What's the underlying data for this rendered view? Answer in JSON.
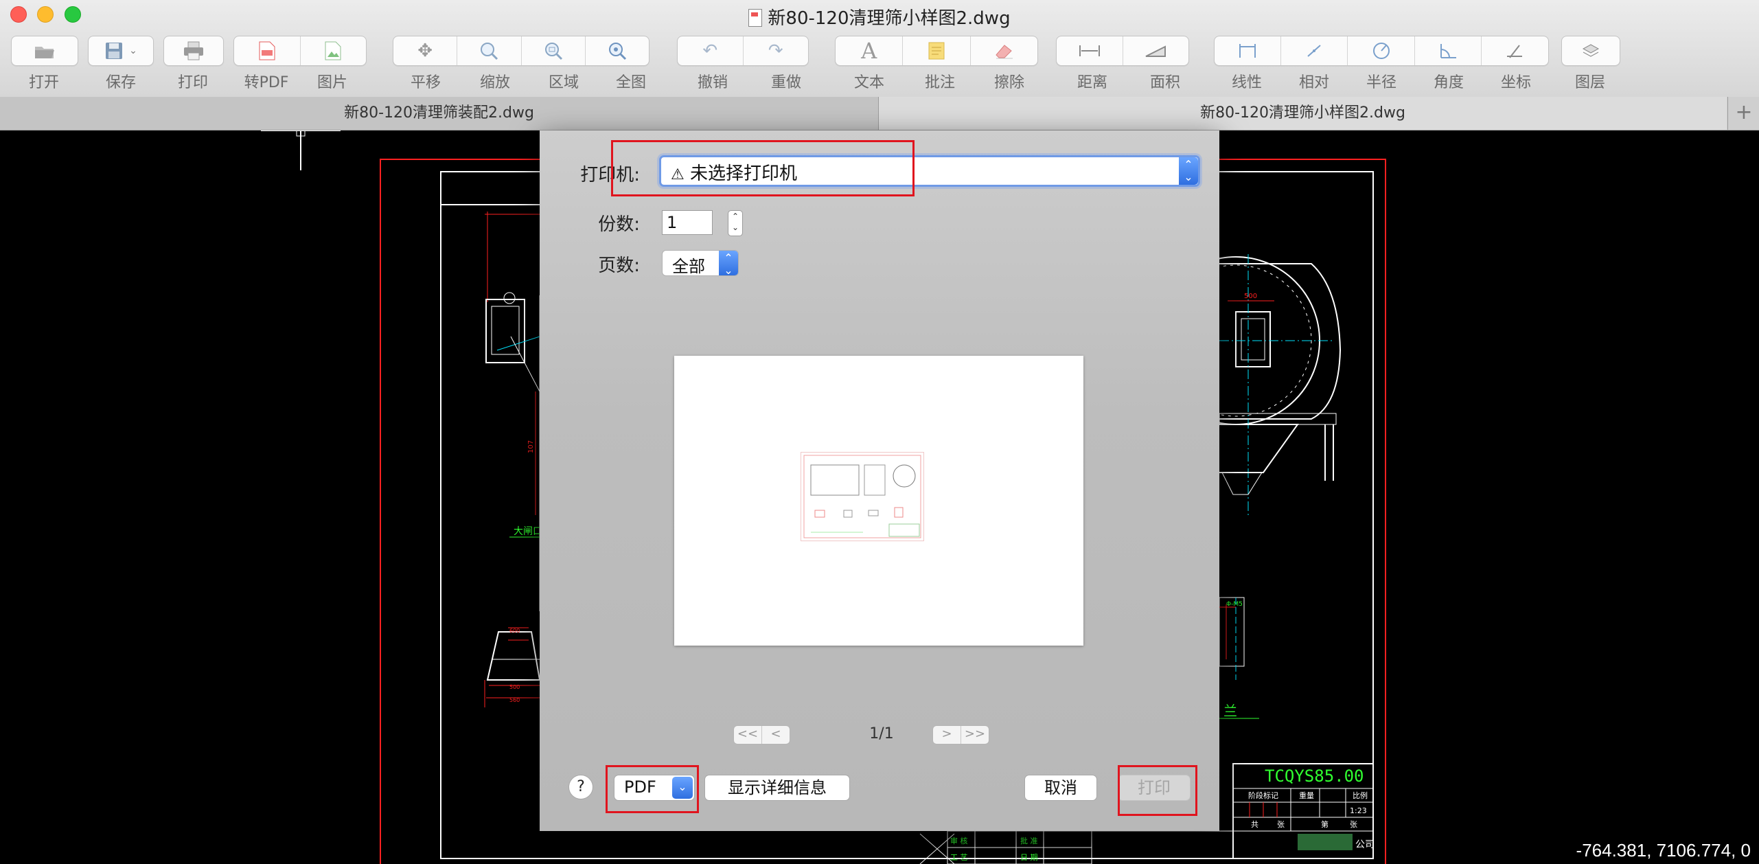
{
  "window": {
    "title": "新80-120清理筛小样图2.dwg"
  },
  "toolbar": {
    "items": [
      {
        "label": "打开",
        "icon": "folder-open-icon"
      },
      {
        "label": "保存",
        "icon": "floppy-disk-icon"
      },
      {
        "label": "打印",
        "icon": "printer-icon"
      },
      {
        "label": "转PDF",
        "icon": "pdf-file-icon"
      },
      {
        "label": "图片",
        "icon": "image-icon"
      },
      {
        "label": "平移",
        "icon": "move-arrows-icon"
      },
      {
        "label": "缩放",
        "icon": "zoom-icon"
      },
      {
        "label": "区域",
        "icon": "zoom-region-icon"
      },
      {
        "label": "全图",
        "icon": "zoom-extents-icon"
      },
      {
        "label": "撤销",
        "icon": "undo-icon"
      },
      {
        "label": "重做",
        "icon": "redo-icon"
      },
      {
        "label": "文本",
        "icon": "text-icon"
      },
      {
        "label": "批注",
        "icon": "note-icon"
      },
      {
        "label": "擦除",
        "icon": "eraser-icon"
      },
      {
        "label": "距离",
        "icon": "distance-icon"
      },
      {
        "label": "面积",
        "icon": "area-icon"
      },
      {
        "label": "线性",
        "icon": "linear-dimension-icon"
      },
      {
        "label": "相对",
        "icon": "aligned-dimension-icon"
      },
      {
        "label": "半径",
        "icon": "radius-icon"
      },
      {
        "label": "角度",
        "icon": "angle-icon"
      },
      {
        "label": "坐标",
        "icon": "coordinate-icon"
      },
      {
        "label": "图层",
        "icon": "layers-icon"
      }
    ]
  },
  "tabs": [
    {
      "label": "新80-120清理筛装配2.dwg",
      "active": false
    },
    {
      "label": "新80-120清理筛小样图2.dwg",
      "active": true
    }
  ],
  "canvas": {
    "coordinates": "-764.381, 7106.774, 0",
    "drawing_texts": {
      "dim_top": "500",
      "label_left": "大闸口",
      "dim_a": "600",
      "dim_b": "500",
      "dim_c": "560",
      "label_flange": "兰",
      "title_code": "TCQYS85.00",
      "tb_header": [
        "阶段标记",
        "重量",
        "比例"
      ],
      "tb_scale": "1:23",
      "tb_row2": [
        "共",
        "张",
        "第",
        "张"
      ],
      "tb_approve": [
        "审 核",
        "工 艺",
        "批 准",
        "日 期"
      ],
      "tb_company": "公司"
    }
  },
  "print_dialog": {
    "printer_label": "打印机:",
    "printer_value": "未选择打印机",
    "copies_label": "份数:",
    "copies_value": "1",
    "pages_label": "页数:",
    "pages_value": "全部",
    "page_indicator": "1/1",
    "nav": {
      "first": "<<",
      "prev": "<",
      "next": ">",
      "last": ">>"
    },
    "help_label": "?",
    "pdf_label": "PDF",
    "details_label": "显示详细信息",
    "cancel_label": "取消",
    "print_label": "打印"
  },
  "colors": {
    "highlight": "#e0141e",
    "cad_red": "#ff2020",
    "cad_white": "#ffffff",
    "cad_cyan": "#00e5ff",
    "cad_green": "#30ff30",
    "accent_blue": "#2f6fe0"
  }
}
